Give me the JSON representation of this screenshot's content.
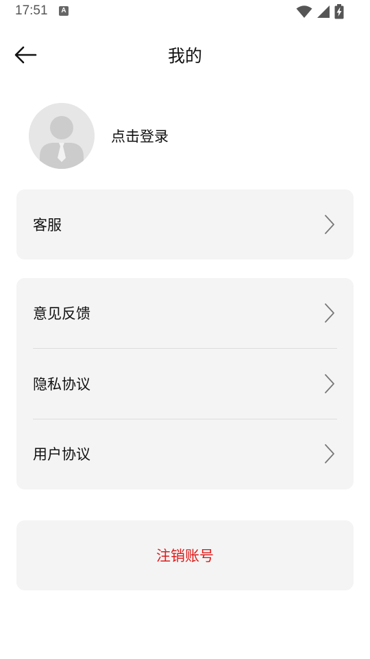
{
  "status_bar": {
    "time": "17:51",
    "notification_icon": "a-icon",
    "icons": [
      "wifi-icon",
      "signal-icon",
      "battery-charging-icon"
    ]
  },
  "header": {
    "back_icon": "arrow-left-icon",
    "title": "我的"
  },
  "profile": {
    "avatar_icon": "default-user-avatar",
    "login_label": "点击登录"
  },
  "menu": {
    "customer_service": {
      "label": "客服",
      "icon": "chevron-right-icon"
    },
    "group": [
      {
        "label": "意见反馈",
        "icon": "chevron-right-icon"
      },
      {
        "label": "隐私协议",
        "icon": "chevron-right-icon"
      },
      {
        "label": "用户协议",
        "icon": "chevron-right-icon"
      }
    ]
  },
  "logout": {
    "label": "注销账号",
    "color": "#e01a1a"
  },
  "colors": {
    "card_background": "#f4f4f4",
    "divider": "#dcdcdc",
    "danger": "#e01a1a"
  }
}
